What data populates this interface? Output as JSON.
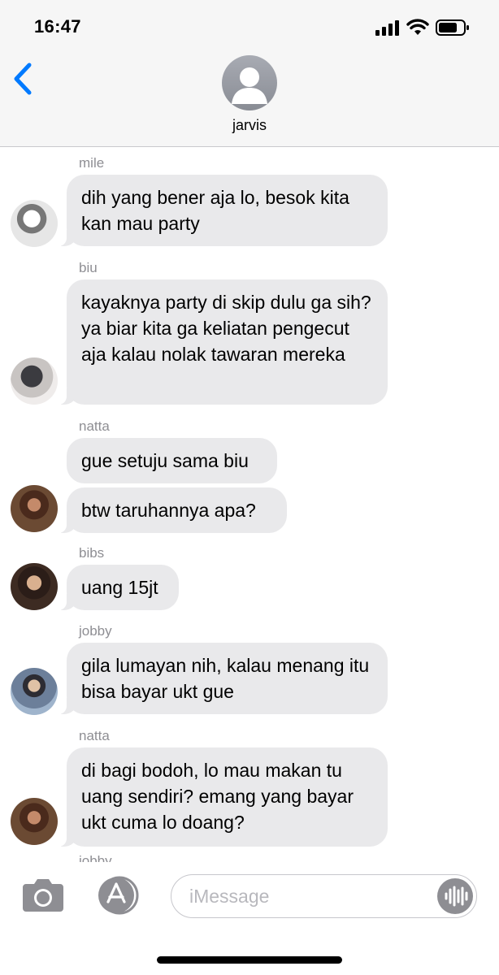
{
  "status_bar": {
    "time": "16:47"
  },
  "header": {
    "contact_name": "jarvis"
  },
  "messages": [
    {
      "sender": "mile",
      "text": "dih yang bener aja lo, besok kita kan mau party"
    },
    {
      "sender": "biu",
      "text": "kayaknya party di skip dulu ga sih? ya biar kita ga keliatan pengecut aja kalau nolak tawaran mereka"
    },
    {
      "sender": "natta",
      "text": "gue setuju sama biu"
    },
    {
      "sender": "",
      "text": "btw taruhannya apa?"
    },
    {
      "sender": "bibs",
      "text": "uang 15jt"
    },
    {
      "sender": "jobby",
      "text": "gila lumayan nih, kalau menang itu bisa bayar ukt gue"
    },
    {
      "sender": "natta",
      "text": "di bagi bodoh, lo mau makan tu uang sendiri? emang yang bayar ukt cuma lo doang?"
    },
    {
      "sender": "jobby",
      "text": ""
    }
  ],
  "composer": {
    "placeholder": "iMessage"
  },
  "colors": {
    "accent": "#007aff",
    "bubble": "#e9e9eb",
    "sender_label": "#8e8e93"
  }
}
